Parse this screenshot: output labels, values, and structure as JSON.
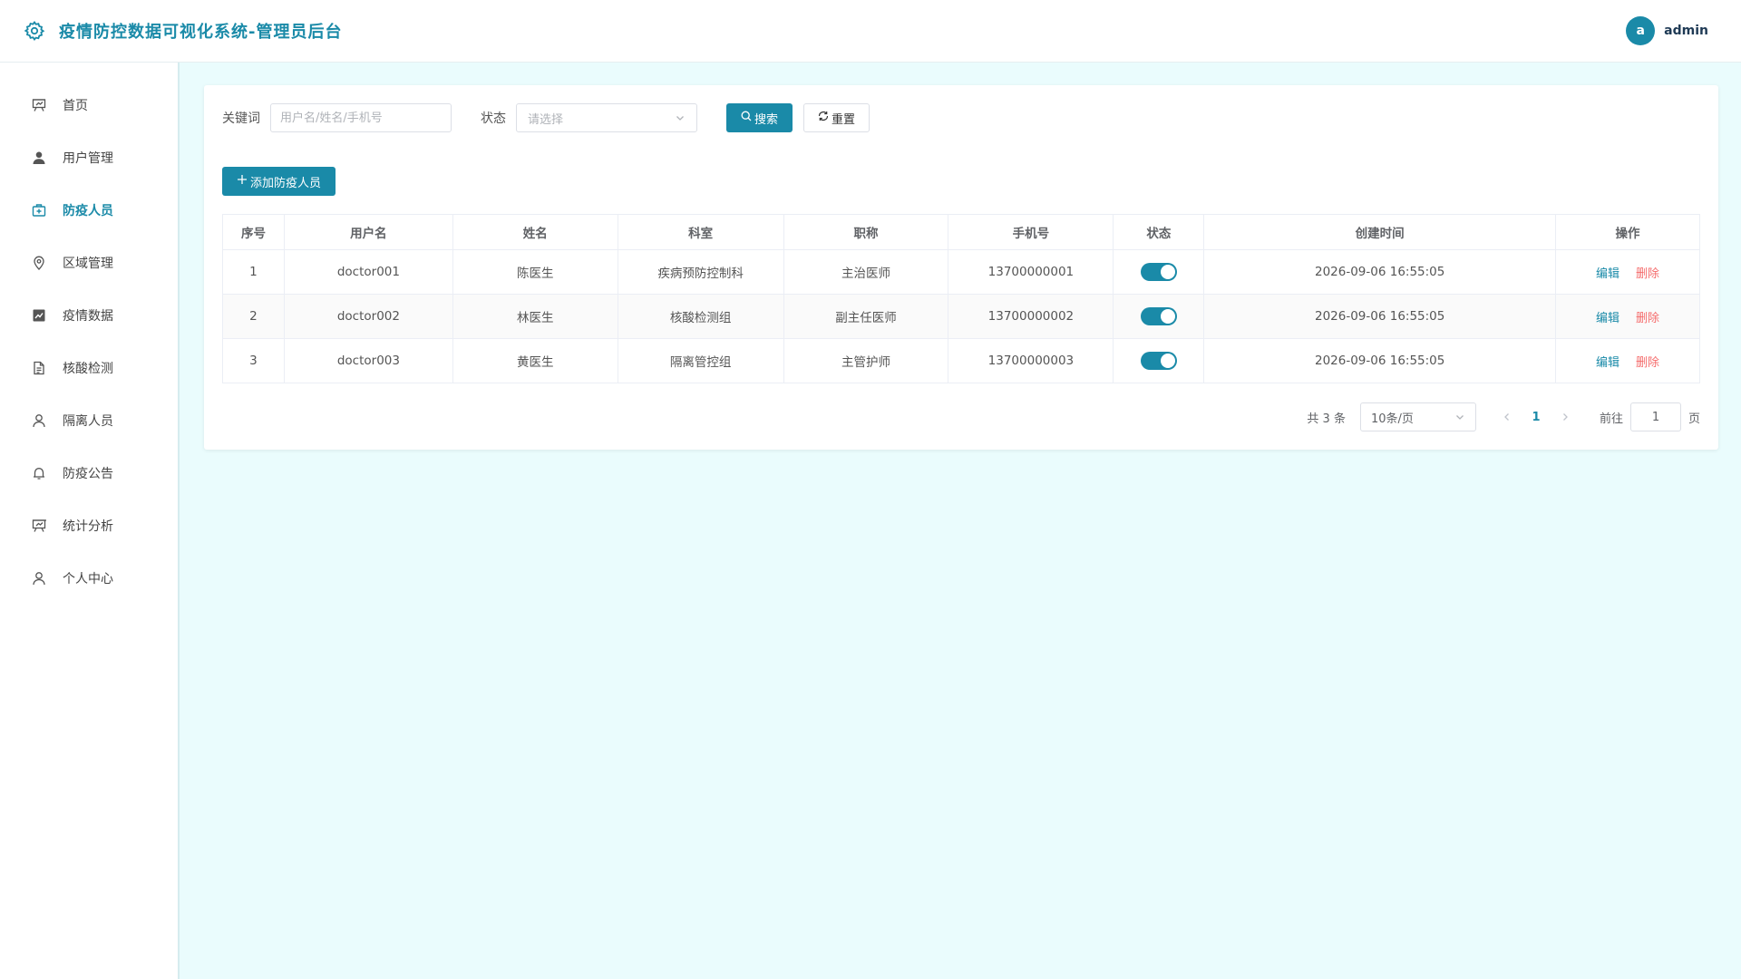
{
  "header": {
    "title": "疫情防控数据可视化系统-管理员后台",
    "logo_icon": "gear-icon",
    "avatar_letter": "a",
    "username": "admin"
  },
  "sidebar": {
    "items": [
      {
        "label": "首页",
        "icon": "presentation-board-icon",
        "active": false
      },
      {
        "label": "用户管理",
        "icon": "user-filled-icon",
        "active": false
      },
      {
        "label": "防疫人员",
        "icon": "first-aid-kit-icon",
        "active": true
      },
      {
        "label": "区域管理",
        "icon": "location-pin-icon",
        "active": false
      },
      {
        "label": "疫情数据",
        "icon": "trend-chart-icon",
        "active": false
      },
      {
        "label": "核酸检测",
        "icon": "document-icon",
        "active": false
      },
      {
        "label": "隔离人员",
        "icon": "user-outline-icon",
        "active": false
      },
      {
        "label": "防疫公告",
        "icon": "bell-icon",
        "active": false
      },
      {
        "label": "统计分析",
        "icon": "presentation-board-icon",
        "active": false
      },
      {
        "label": "个人中心",
        "icon": "user-outline-icon",
        "active": false
      }
    ]
  },
  "filter": {
    "keyword_label": "关键词",
    "keyword_placeholder": "用户名/姓名/手机号",
    "keyword_value": "",
    "status_label": "状态",
    "status_placeholder": "请选择",
    "search_label": "搜索",
    "reset_label": "重置"
  },
  "actions": {
    "add_label": "添加防疫人员"
  },
  "table": {
    "headers": [
      "序号",
      "用户名",
      "姓名",
      "科室",
      "职称",
      "手机号",
      "状态",
      "创建时间",
      "操作"
    ],
    "rows": [
      {
        "index": "1",
        "username": "doctor001",
        "name": "陈医生",
        "department": "疾病预防控制科",
        "title": "主治医师",
        "phone": "13700000001",
        "status_on": true,
        "created": "2026-09-06 16:55:05"
      },
      {
        "index": "2",
        "username": "doctor002",
        "name": "林医生",
        "department": "核酸检测组",
        "title": "副主任医师",
        "phone": "13700000002",
        "status_on": true,
        "created": "2026-09-06 16:55:05"
      },
      {
        "index": "3",
        "username": "doctor003",
        "name": "黄医生",
        "department": "隔离管控组",
        "title": "主管护师",
        "phone": "13700000003",
        "status_on": true,
        "created": "2026-09-06 16:55:05"
      }
    ],
    "edit_label": "编辑",
    "delete_label": "删除"
  },
  "pagination": {
    "total_text": "共 3 条",
    "page_size": "10条/页",
    "current_page": "1",
    "goto_label": "前往",
    "goto_value": "1",
    "page_suffix": "页"
  },
  "colors": {
    "primary": "#1a8aa8",
    "danger": "#f56c6c",
    "background": "#eafcfd"
  }
}
